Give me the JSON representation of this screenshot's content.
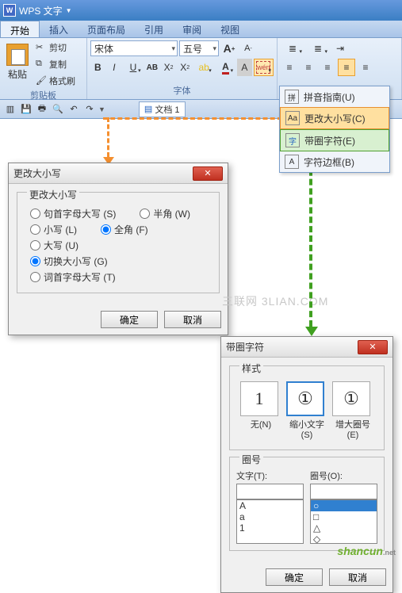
{
  "titlebar": {
    "app": "WPS 文字"
  },
  "tabs": [
    "开始",
    "插入",
    "页面布局",
    "引用",
    "审阅",
    "视图"
  ],
  "ribbon": {
    "clipboard": {
      "paste": "粘贴",
      "cut": "剪切",
      "copy": "复制",
      "fmt": "格式刷",
      "label": "剪贴板"
    },
    "font": {
      "name": "宋体",
      "size": "五号",
      "label": "字体",
      "wen": "wén",
      "aa_big": "A",
      "aa_small": "A"
    }
  },
  "qat": {
    "doc": "文档 1"
  },
  "dropdown": {
    "items": [
      {
        "icon": "拼",
        "label": "拼音指南(U)"
      },
      {
        "icon": "Aa",
        "label": "更改大小写(C)"
      },
      {
        "icon": "字",
        "label": "带圈字符(E)"
      },
      {
        "icon": "A",
        "label": "字符边框(B)"
      }
    ]
  },
  "dialog1": {
    "title": "更改大小写",
    "group": "更改大小写",
    "opts": {
      "sentence": "句首字母大写 (S)",
      "half": "半角 (W)",
      "lower": "小写 (L)",
      "full": "全角 (F)",
      "upper": "大写 (U)",
      "toggle": "切换大小写 (G)",
      "titlecase": "词首字母大写 (T)"
    },
    "ok": "确定",
    "cancel": "取消"
  },
  "dialog2": {
    "title": "带圈字符",
    "style_label": "样式",
    "styles": [
      {
        "glyph": "1",
        "label": "无(N)"
      },
      {
        "glyph": "①",
        "label": "缩小文字(S)"
      },
      {
        "glyph": "①",
        "label": "增大圈号(E)"
      }
    ],
    "ring_label": "圈号",
    "text_label": "文字(T):",
    "ring_list_label": "圈号(O):",
    "text_value": "",
    "text_list": [
      "A",
      "a",
      "1"
    ],
    "ring_list": [
      "○",
      "□",
      "△",
      "◇"
    ],
    "ok": "确定",
    "cancel": "取消"
  },
  "watermark": "三联网 3LIAN.COM",
  "watermark2": "shancun",
  "watermark2_sub": ".net"
}
